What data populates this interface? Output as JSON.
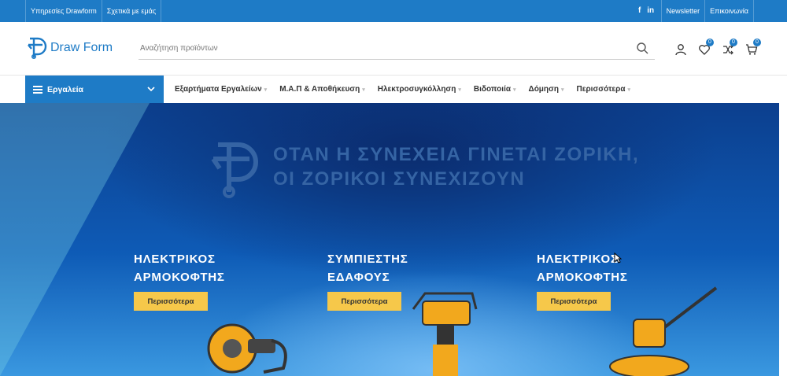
{
  "topbar": {
    "links": [
      "Υπηρεσίες Drawform",
      "Σχετικά με εμάς"
    ],
    "social": [
      "f",
      "in"
    ],
    "right_links": [
      "Newsletter",
      "Επικοινωνία"
    ]
  },
  "header": {
    "logo_text": "Draw Form",
    "search_placeholder": "Αναζήτηση προϊόντων",
    "wishlist_count": "0",
    "compare_count": "0",
    "cart_count": "0"
  },
  "nav": {
    "category_label": "Εργαλεία",
    "items": [
      "Εξαρτήματα Εργαλείων",
      "Μ.Α.Π & Αποθήκευση",
      "Ηλεκτροσυγκόλληση",
      "Βιδοποιία",
      "Δόμηση",
      "Περισσότερα"
    ]
  },
  "hero": {
    "slogan_line1": "ΟΤΑΝ Η ΣΥΝΕΧΕΙΑ ΓΙΝΕΤΑΙ ΖΟΡΙΚΗ,",
    "slogan_line2": "ΟΙ ΖΟΡΙΚΟΙ ΣΥΝΕΧΙΖΟΥΝ",
    "products": [
      {
        "line1": "ΗΛΕΚΤΡΙΚΟΣ",
        "line2": "ΑΡΜΟΚΟΦΤΗΣ",
        "button": "Περισσότερα"
      },
      {
        "line1": "ΣΥΜΠΙΕΣΤΗΣ",
        "line2": "ΕΔΑΦΟΥΣ",
        "button": "Περισσότερα"
      },
      {
        "line1": "ΗΛΕΚΤΡΙΚΟΣ",
        "line2": "ΑΡΜΟΚΟΦΤΗΣ",
        "button": "Περισσότερα"
      }
    ]
  },
  "colors": {
    "brand": "#1e7bc6",
    "button": "#f6c84a",
    "hero_dark": "#0c3f8e"
  }
}
